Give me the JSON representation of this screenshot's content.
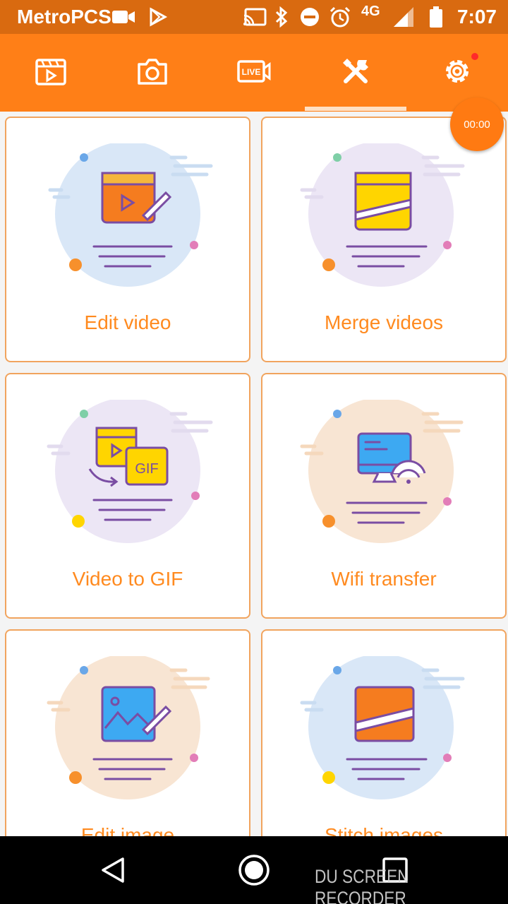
{
  "status_bar": {
    "carrier": "MetroPCS",
    "network": "4G",
    "time": "7:07",
    "icons": [
      "video-record-icon",
      "play-store-icon",
      "cast-icon",
      "bluetooth-icon",
      "do-not-disturb-icon",
      "alarm-icon",
      "signal-icon",
      "battery-icon"
    ]
  },
  "toolbar": {
    "tabs": [
      {
        "icon": "video-library-icon"
      },
      {
        "icon": "camera-icon"
      },
      {
        "icon": "live-icon",
        "text": "LIVE"
      },
      {
        "icon": "tools-icon",
        "selected": true
      },
      {
        "icon": "settings-icon",
        "has_notification": true
      }
    ],
    "accent": "#ff7f17"
  },
  "timer": {
    "text": "00:00"
  },
  "tools": [
    {
      "label": "Edit video",
      "icon": "edit-video-icon"
    },
    {
      "label": "Merge videos",
      "icon": "merge-videos-icon"
    },
    {
      "label": "Video to GIF",
      "icon": "video-to-gif-icon",
      "badge": "GIF"
    },
    {
      "label": "Wifi transfer",
      "icon": "wifi-transfer-icon"
    },
    {
      "label": "Edit image",
      "icon": "edit-image-icon"
    },
    {
      "label": "Stitch images",
      "icon": "stitch-images-icon"
    }
  ],
  "nav_bar": {
    "buttons": [
      "back-icon",
      "home-icon",
      "recents-icon"
    ]
  },
  "watermark": "DU SCREEN RECORDER"
}
